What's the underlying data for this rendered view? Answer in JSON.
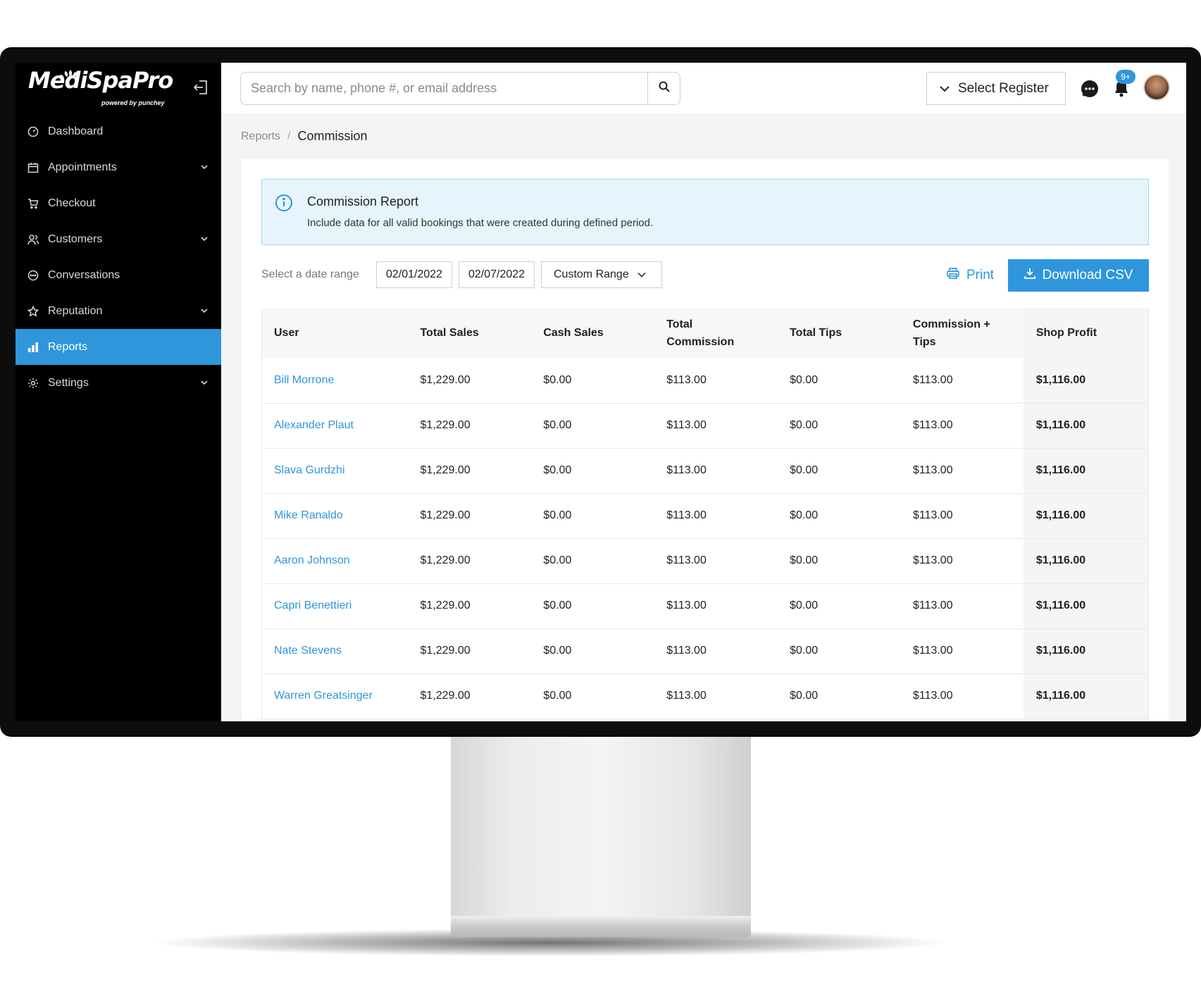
{
  "brand": {
    "name": "MediSpaPro",
    "tagline": "powered by punchey"
  },
  "sidebar": {
    "items": [
      {
        "label": "Dashboard",
        "icon": "dashboard-icon",
        "has_chevron": false,
        "active": false
      },
      {
        "label": "Appointments",
        "icon": "calendar-icon",
        "has_chevron": true,
        "active": false
      },
      {
        "label": "Checkout",
        "icon": "cart-icon",
        "has_chevron": false,
        "active": false
      },
      {
        "label": "Customers",
        "icon": "customers-icon",
        "has_chevron": true,
        "active": false
      },
      {
        "label": "Conversations",
        "icon": "chat-bubble-icon",
        "has_chevron": false,
        "active": false
      },
      {
        "label": "Reputation",
        "icon": "star-icon",
        "has_chevron": true,
        "active": false
      },
      {
        "label": "Reports",
        "icon": "bar-chart-icon",
        "has_chevron": false,
        "active": true
      },
      {
        "label": "Settings",
        "icon": "gear-icon",
        "has_chevron": true,
        "active": false
      }
    ]
  },
  "topbar": {
    "search_placeholder": "Search by name, phone #, or email address",
    "register_label": "Select Register",
    "notification_count": "9+"
  },
  "breadcrumb": {
    "parent": "Reports",
    "separator": "/",
    "current": "Commission"
  },
  "info": {
    "title": "Commission Report",
    "description": "Include data for all valid bookings that were created during defined period."
  },
  "filters": {
    "label": "Select a date range",
    "date_from": "02/01/2022",
    "date_to": "02/07/2022",
    "range": "Custom Range",
    "print_label": "Print",
    "download_label": "Download CSV"
  },
  "table": {
    "headers": [
      "User",
      "Total Sales",
      "Cash Sales",
      "Total Commission",
      "Total Tips",
      "Commission + Tips",
      "Shop Profit"
    ],
    "rows": [
      [
        "Bill Morrone",
        "$1,229.00",
        "$0.00",
        "$113.00",
        "$0.00",
        "$113.00",
        "$1,116.00"
      ],
      [
        "Alexander Plaut",
        "$1,229.00",
        "$0.00",
        "$113.00",
        "$0.00",
        "$113.00",
        "$1,116.00"
      ],
      [
        "Slava Gurdzhi",
        "$1,229.00",
        "$0.00",
        "$113.00",
        "$0.00",
        "$113.00",
        "$1,116.00"
      ],
      [
        "Mike Ranaldo",
        "$1,229.00",
        "$0.00",
        "$113.00",
        "$0.00",
        "$113.00",
        "$1,116.00"
      ],
      [
        "Aaron Johnson",
        "$1,229.00",
        "$0.00",
        "$113.00",
        "$0.00",
        "$113.00",
        "$1,116.00"
      ],
      [
        "Capri Benettieri",
        "$1,229.00",
        "$0.00",
        "$113.00",
        "$0.00",
        "$113.00",
        "$1,116.00"
      ],
      [
        "Nate Stevens",
        "$1,229.00",
        "$0.00",
        "$113.00",
        "$0.00",
        "$113.00",
        "$1,116.00"
      ],
      [
        "Warren Greatsinger",
        "$1,229.00",
        "$0.00",
        "$113.00",
        "$0.00",
        "$113.00",
        "$1,116.00"
      ]
    ]
  },
  "colors": {
    "accent": "#2f96dc",
    "sidebar_bg": "#000000",
    "info_bg": "#e6f5fd",
    "info_border": "#9fd4f3"
  }
}
